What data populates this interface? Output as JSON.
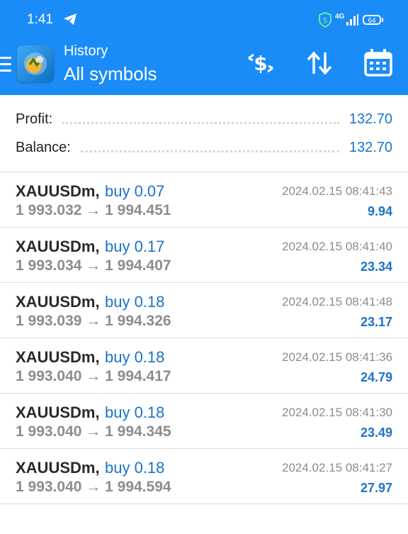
{
  "status_bar": {
    "time": "1:41",
    "network": "4G",
    "battery": "64"
  },
  "header": {
    "subtitle": "History",
    "title": "All symbols"
  },
  "summary": {
    "profit_label": "Profit:",
    "profit_value": "132.70",
    "balance_label": "Balance:",
    "balance_value": "132.70"
  },
  "trades": [
    {
      "symbol": "XAUUSDm,",
      "side": "buy 0.07",
      "open": "1 993.032",
      "arrow": "→",
      "close": "1 994.451",
      "time": "2024.02.15 08:41:43",
      "profit": "9.94"
    },
    {
      "symbol": "XAUUSDm,",
      "side": "buy 0.17",
      "open": "1 993.034",
      "arrow": "→",
      "close": "1 994.407",
      "time": "2024.02.15 08:41:40",
      "profit": "23.34"
    },
    {
      "symbol": "XAUUSDm,",
      "side": "buy 0.18",
      "open": "1 993.039",
      "arrow": "→",
      "close": "1 994.326",
      "time": "2024.02.15 08:41:48",
      "profit": "23.17"
    },
    {
      "symbol": "XAUUSDm,",
      "side": "buy 0.18",
      "open": "1 993.040",
      "arrow": "→",
      "close": "1 994.417",
      "time": "2024.02.15 08:41:36",
      "profit": "24.79"
    },
    {
      "symbol": "XAUUSDm,",
      "side": "buy 0.18",
      "open": "1 993.040",
      "arrow": "→",
      "close": "1 994.345",
      "time": "2024.02.15 08:41:30",
      "profit": "23.49"
    },
    {
      "symbol": "XAUUSDm,",
      "side": "buy 0.18",
      "open": "1 993.040",
      "arrow": "→",
      "close": "1 994.594",
      "time": "2024.02.15 08:41:27",
      "profit": "27.97"
    }
  ],
  "icons": {
    "menu": "hamburger-icon",
    "deposit": "dollar-arrows-icon",
    "sort": "sort-arrows-icon",
    "calendar": "calendar-icon"
  },
  "colors": {
    "header_bg": "#1a8cf7",
    "accent": "#1a73c8",
    "secondary_text": "#8c8c8c"
  }
}
